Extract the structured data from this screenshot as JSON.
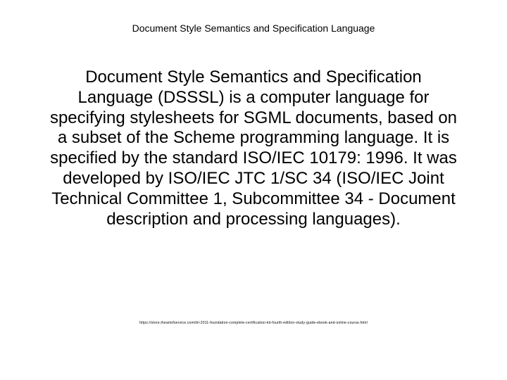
{
  "header": {
    "title": "Document Style Semantics and Specification Language"
  },
  "body": {
    "paragraph": "Document Style Semantics and Specification Language (DSSSL) is a computer language for specifying stylesheets for SGML documents, based on a subset of the Scheme programming language. It is specified by the standard ISO/IEC 10179: 1996. It was developed by ISO/IEC JTC 1/SC 34 (ISO/IEC Joint Technical Committee 1, Subcommittee 34 - Document description and processing languages)."
  },
  "footer": {
    "url": "https://store.theartofservice.com/itil-2011-foundation-complete-certification-kit-fourth-edition-study-guide-ebook-and-online-course.html"
  }
}
